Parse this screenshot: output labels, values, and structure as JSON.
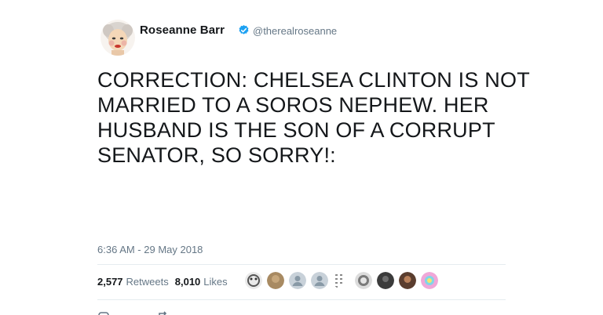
{
  "tweet": {
    "display_name": "Roseanne Barr",
    "handle": "@therealroseanne",
    "text_lines": [
      "CORRECTION: CHELSEA CLINTON IS NOT",
      "MARRIED TO A SOROS NEPHEW. HER",
      "HUSBAND IS THE SON OF A CORRUPT",
      "SENATOR, SO SORRY!:"
    ],
    "timestamp": "6:36 AM - 29 May 2018",
    "retweets_count": "2,577",
    "retweets_label": "Retweets",
    "likes_count": "8,010",
    "likes_label": "Likes"
  },
  "colors": {
    "text": "#14171a",
    "secondary": "#657786",
    "verified_blue": "#1da1f2",
    "divider": "#e6ecf0"
  },
  "icons": {
    "verified": "verified-badge-icon",
    "reply": "reply-icon",
    "retweet": "retweet-icon"
  }
}
